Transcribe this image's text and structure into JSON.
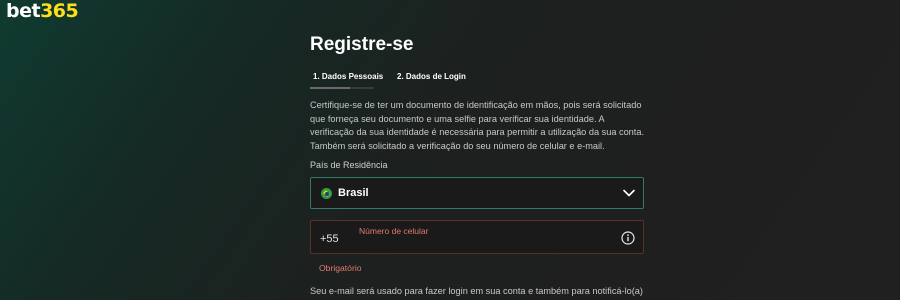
{
  "brand": {
    "logo_white": "bet",
    "logo_yellow": "365"
  },
  "page": {
    "title": "Registre-se"
  },
  "steps": [
    {
      "label": "1.  Dados Pessoais"
    },
    {
      "label": "2.  Dados de Login"
    }
  ],
  "intro": "Certifique-se de ter um documento de identificação em mãos, pois será solicitado que forneça seu documento e uma selfie para verificar sua identidade. A verificação da sua identidade é necessária para permitir a utilização da sua conta. Também será solicitado a verificação do seu número de celular e e-mail.",
  "country": {
    "label": "País de Residência",
    "value": "Brasil"
  },
  "phone": {
    "prefix": "+55",
    "floating_label": "Número de celular",
    "error": "Obrigatório"
  },
  "email_note": "Seu e-mail será usado para fazer login em sua conta e também para notificá-lo(a) sobre",
  "colors": {
    "brand_yellow": "#ffdf1b",
    "valid_border": "#2f7a62",
    "error": "#e07a6e"
  },
  "icons": [
    "brazil-flag-icon",
    "chevron-down-icon",
    "info-icon"
  ]
}
